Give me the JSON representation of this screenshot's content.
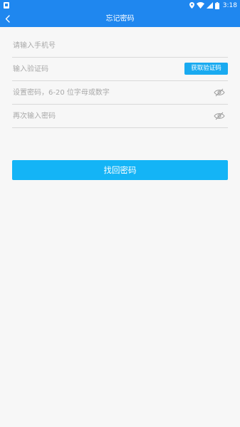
{
  "status_bar": {
    "time": "3:18",
    "icons": [
      "notification-icon",
      "location-icon",
      "wifi-icon",
      "signal-icon",
      "battery-icon"
    ]
  },
  "app_bar": {
    "title": "忘记密码",
    "back_icon": "back-chevron-icon"
  },
  "form": {
    "phone_placeholder": "请输入手机号",
    "code_placeholder": "输入验证码",
    "get_code_label": "获取验证码",
    "password_placeholder": "设置密码，6-20 位字母或数字",
    "confirm_placeholder": "再次输入密码",
    "visibility_icon": "eye-hidden-icon"
  },
  "submit": {
    "label": "找回密码"
  },
  "colors": {
    "primary": "#1f87ef",
    "button": "#14b4f6",
    "code_button": "#19aaf0",
    "background": "#f7f7f7",
    "divider": "#d9d9d9",
    "placeholder": "#a9a9a9"
  }
}
